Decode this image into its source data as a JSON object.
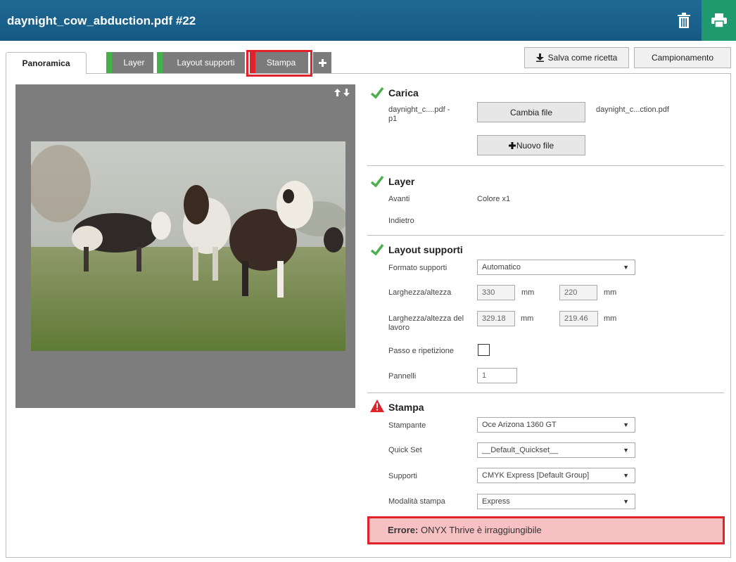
{
  "header": {
    "title": "daynight_cow_abduction.pdf #22",
    "colors": {
      "bar": "#1a6390",
      "print": "#1f9a6e"
    }
  },
  "tabs": [
    {
      "label": "Panoramica",
      "active": true
    },
    {
      "label": "Layer",
      "status": "green"
    },
    {
      "label": "Layout supporti",
      "status": "green"
    },
    {
      "label": "Stampa",
      "status": "red"
    },
    {
      "label": "+"
    }
  ],
  "actions": {
    "save_recipe": "Salva come ricetta",
    "sampling": "Campionamento"
  },
  "carica": {
    "title": "Carica",
    "file_label": "daynight_c....pdf - p1",
    "change_file": "Cambia file",
    "file_name": "daynight_c...ction.pdf",
    "new_file": "Nuovo file"
  },
  "layer": {
    "title": "Layer",
    "front_label": "Avanti",
    "front_value": "Colore x1",
    "back_label": "Indietro"
  },
  "layout": {
    "title": "Layout supporti",
    "format_label": "Formato supporti",
    "format_value": "Automatico",
    "size_label": "Larghezza/altezza",
    "width": "330",
    "height": "220",
    "unit": "mm",
    "job_size_label": "Larghezza/altezza del lavoro",
    "job_width": "329.18",
    "job_height": "219.46",
    "step_repeat_label": "Passo e ripetizione",
    "panels_label": "Pannelli",
    "panels_value": "1"
  },
  "stampa": {
    "title": "Stampa",
    "printer_label": "Stampante",
    "printer_value": "Oce Arizona 1360 GT",
    "quickset_label": "Quick Set",
    "quickset_value": "__Default_Quickset__",
    "media_label": "Supporti",
    "media_value": "CMYK Express [Default Group]",
    "mode_label": "Modalità stampa",
    "mode_value": "Express"
  },
  "error": {
    "prefix": "Errore:",
    "message": " ONYX Thrive è irraggiungibile"
  }
}
